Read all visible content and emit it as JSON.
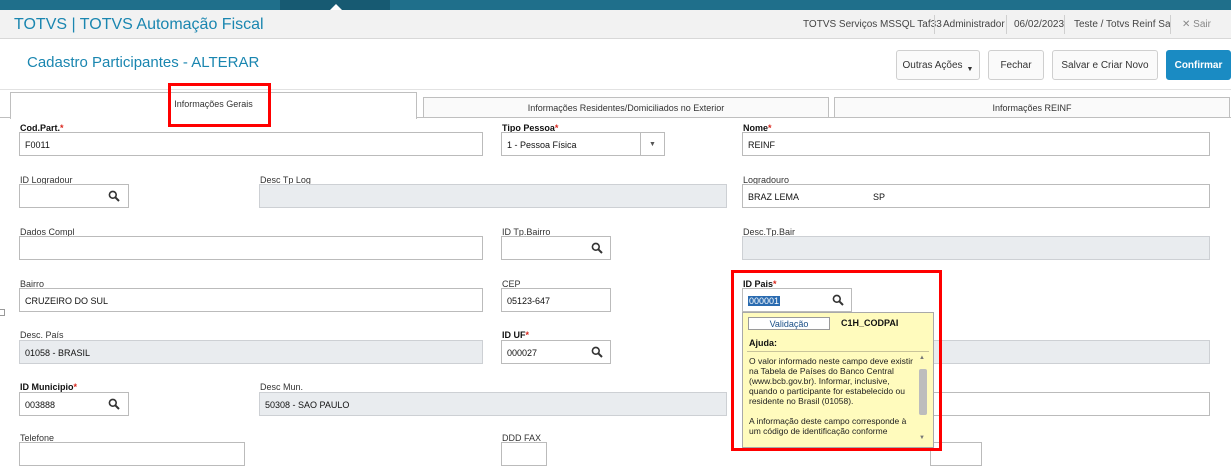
{
  "titlebar": {
    "app_title": "TOTVS | TOTVS Automação Fiscal",
    "environment": "TOTVS Serviços MSSQL Taf33",
    "user": "Administrador",
    "date": "06/02/2023",
    "company": "Teste / Totvs Reinf Sa",
    "exit_label": "Sair"
  },
  "header": {
    "page_title": "Cadastro Participantes - ALTERAR",
    "other_actions_label": "Outras Ações",
    "close_label": "Fechar",
    "save_new_label": "Salvar e Criar Novo",
    "confirm_label": "Confirmar"
  },
  "tabs": [
    {
      "label": "Informações Gerais",
      "active": true
    },
    {
      "label": "Informações Residentes/Domiciliados no Exterior",
      "active": false
    },
    {
      "label": "Informações REINF",
      "active": false
    }
  ],
  "fields": {
    "cod_part": {
      "label": "Cod.Part.",
      "value": "F0011",
      "required": true
    },
    "tipo_pessoa": {
      "label": "Tipo Pessoa",
      "value": "1 - Pessoa Física",
      "required": true
    },
    "nome": {
      "label": "Nome",
      "value": "REINF",
      "required": true
    },
    "id_logradour": {
      "label": "ID Logradour",
      "value": ""
    },
    "desc_tp_log": {
      "label": "Desc Tp Log",
      "value": ""
    },
    "logradouro": {
      "label": "Logradouro",
      "value": "BRAZ LEMA",
      "value2": "SP"
    },
    "dados_compl": {
      "label": "Dados Compl",
      "value": ""
    },
    "id_tp_bairro": {
      "label": "ID Tp.Bairro",
      "value": ""
    },
    "desc_tp_bair": {
      "label": "Desc.Tp.Bair",
      "value": ""
    },
    "bairro": {
      "label": "Bairro",
      "value": "CRUZEIRO DO SUL"
    },
    "cep": {
      "label": "CEP",
      "value": "05123-647"
    },
    "id_pais": {
      "label": "ID Pais",
      "value": "000001",
      "required": true
    },
    "desc_pais": {
      "label": "Desc. País",
      "value": "01058 - BRASIL"
    },
    "id_uf": {
      "label": "ID UF",
      "value": "000027",
      "required": true
    },
    "id_municipio": {
      "label": "ID Municipio",
      "value": "003888",
      "required": true
    },
    "desc_mun": {
      "label": "Desc Mun.",
      "value": "50308 - SAO PAULO"
    },
    "telefone": {
      "label": "Telefone",
      "value": ""
    },
    "ddd_fax": {
      "label": "DDD FAX",
      "value": ""
    }
  },
  "required_mark": "*",
  "tooltip": {
    "validation_button": "Validação",
    "field_code": "C1H_CODPAI",
    "help_title": "Ajuda:",
    "paragraph1": "O valor informado neste campo deve existir na Tabela de Países do Banco Central (www.bcb.gov.br). Informar, inclusive, quando o participante for estabelecido ou residente no Brasil (01058).",
    "paragraph2": "A informação deste campo corresponde à um código de identificação conforme"
  },
  "icons": [
    "search-icon",
    "chevron-down-icon",
    "close-icon",
    "scroll-up-icon",
    "scroll-down-icon"
  ],
  "colors": {
    "accent": "#1a86b0",
    "primary_button": "#1a8bc3",
    "annotation": "#ff0000",
    "tooltip_bg": "#fffbbd",
    "required": "#d9261c"
  }
}
